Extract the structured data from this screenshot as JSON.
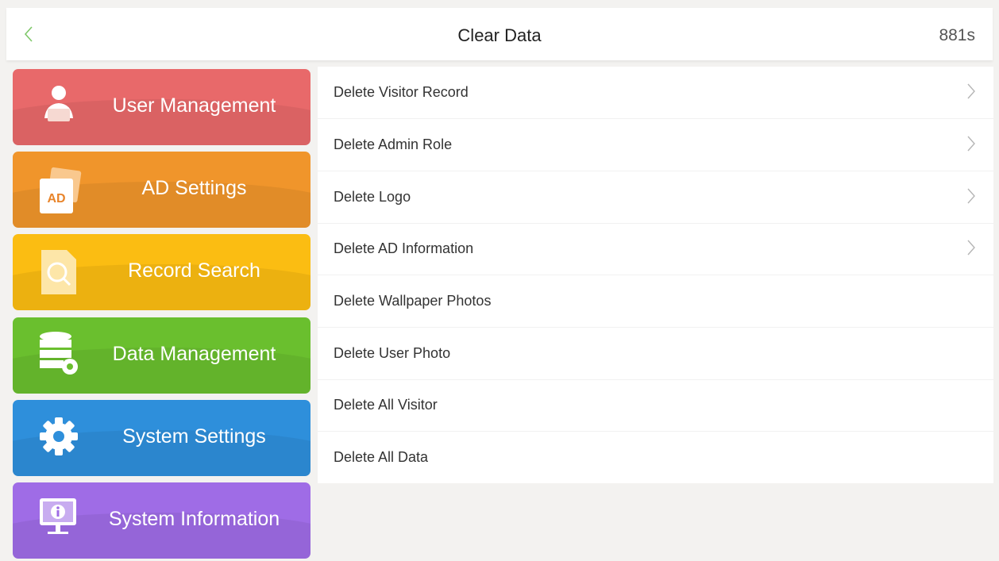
{
  "header": {
    "title": "Clear Data",
    "timer": "881s"
  },
  "sidebar": {
    "items": [
      {
        "label": "User Management",
        "color": "#e8696a",
        "icon": "user-icon"
      },
      {
        "label": "AD Settings",
        "color": "#f0952b",
        "icon": "ad-icon",
        "icon_text": "AD"
      },
      {
        "label": "Record Search",
        "color": "#fbbd12",
        "icon": "search-doc-icon"
      },
      {
        "label": "Data Management",
        "color": "#6abf2e",
        "icon": "database-gear-icon"
      },
      {
        "label": "System Settings",
        "color": "#2e8fdb",
        "icon": "gear-icon"
      },
      {
        "label": "System Information",
        "color": "#9f6ce6",
        "icon": "monitor-info-icon"
      }
    ]
  },
  "list": {
    "items": [
      {
        "label": "Delete Visitor Record",
        "chevron": true
      },
      {
        "label": "Delete Admin Role",
        "chevron": true
      },
      {
        "label": "Delete Logo",
        "chevron": true
      },
      {
        "label": "Delete AD Information",
        "chevron": true
      },
      {
        "label": "Delete Wallpaper Photos",
        "chevron": false
      },
      {
        "label": "Delete User Photo",
        "chevron": false
      },
      {
        "label": "Delete All Visitor",
        "chevron": false
      },
      {
        "label": "Delete All Data",
        "chevron": false
      }
    ]
  }
}
